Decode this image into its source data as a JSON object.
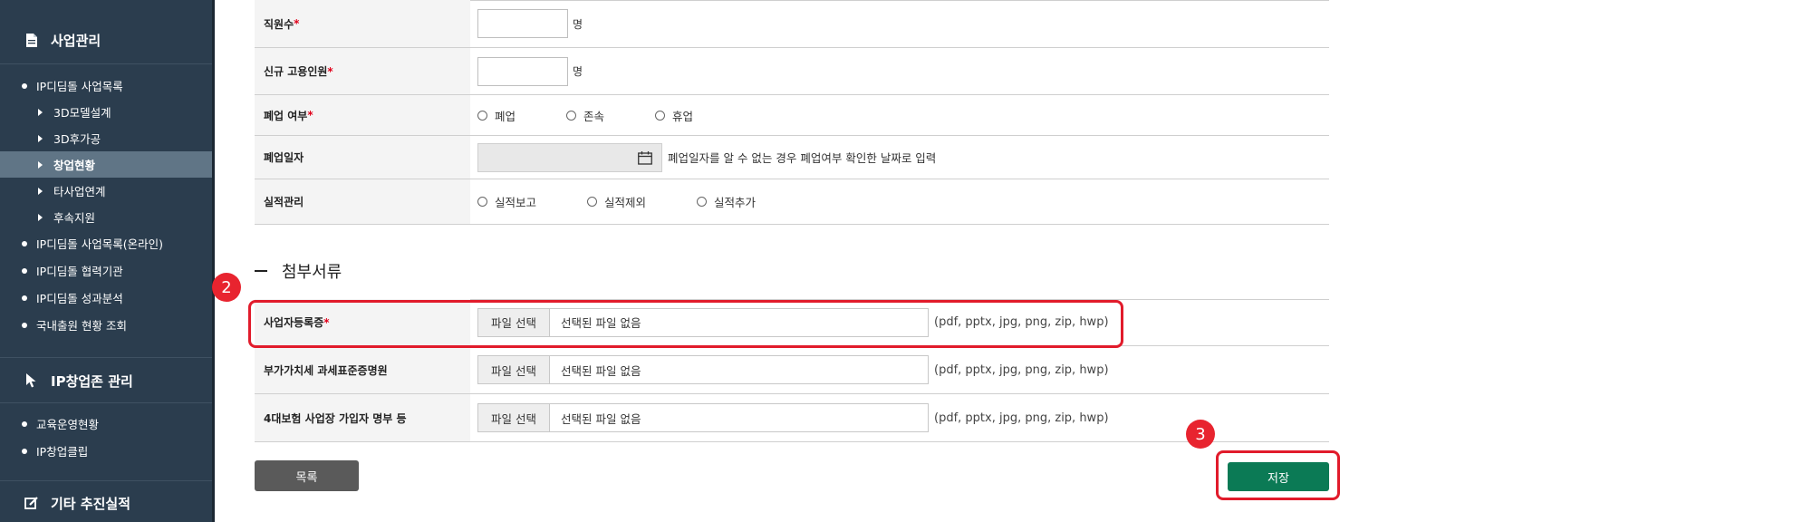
{
  "sidebar": {
    "section1_title": "사업관리",
    "section1_items": [
      {
        "label": "IP디딤돌 사업목록"
      },
      {
        "label": "3D모델설계"
      },
      {
        "label": "3D후가공"
      },
      {
        "label": "창업현황"
      },
      {
        "label": "타사업연계"
      },
      {
        "label": "후속지원"
      },
      {
        "label": "IP디딤돌 사업목록(온라인)"
      },
      {
        "label": "IP디딤돌 협력기관"
      },
      {
        "label": "IP디딤돌 성과분석"
      },
      {
        "label": "국내출원 현황 조회"
      }
    ],
    "section2_title": "IP창업존 관리",
    "section2_items": [
      {
        "label": "교육운영현황"
      },
      {
        "label": "IP창업클립"
      }
    ],
    "section3_title": "기타 추진실적"
  },
  "form": {
    "employees": {
      "label": "직원수",
      "req": "*",
      "unit": "명",
      "value": ""
    },
    "new_hires": {
      "label": "신규 고용인원",
      "req": "*",
      "unit": "명",
      "value": ""
    },
    "closure": {
      "label": "폐업 여부",
      "req": "*",
      "options": [
        "폐업",
        "존속",
        "휴업"
      ]
    },
    "closure_date": {
      "label": "폐업일자",
      "hint": "폐업일자를 알 수 없는 경우 폐업여부 확인한 날짜로 입력"
    },
    "performance": {
      "label": "실적관리",
      "options": [
        "실적보고",
        "실적제외",
        "실적추가"
      ]
    }
  },
  "attachments": {
    "section_title": "첨부서류",
    "rows": [
      {
        "label": "사업자등록증",
        "req": "*",
        "button": "파일 선택",
        "filename": "선택된 파일 없음",
        "ext": "(pdf, pptx, jpg, png, zip, hwp)"
      },
      {
        "label": "부가가치세 과세표준증명원",
        "req": "",
        "button": "파일 선택",
        "filename": "선택된 파일 없음",
        "ext": "(pdf, pptx, jpg, png, zip, hwp)"
      },
      {
        "label": "4대보험 사업장 가입자 명부 등",
        "req": "",
        "button": "파일 선택",
        "filename": "선택된 파일 없음",
        "ext": "(pdf, pptx, jpg, png, zip, hwp)"
      }
    ]
  },
  "buttons": {
    "list": "목록",
    "save": "저장"
  },
  "callouts": {
    "badge2": "2",
    "badge3": "3"
  },
  "colors": {
    "sidebar_bg": "#2b3d4e",
    "active_item": "#607586",
    "save_button": "#0b7a55",
    "callout": "#e11b2b",
    "required": "#e0001a"
  },
  "icons": {
    "section1": "document-icon",
    "section2": "cursor-icon",
    "section3": "edit-icon",
    "date": "calendar-icon"
  }
}
